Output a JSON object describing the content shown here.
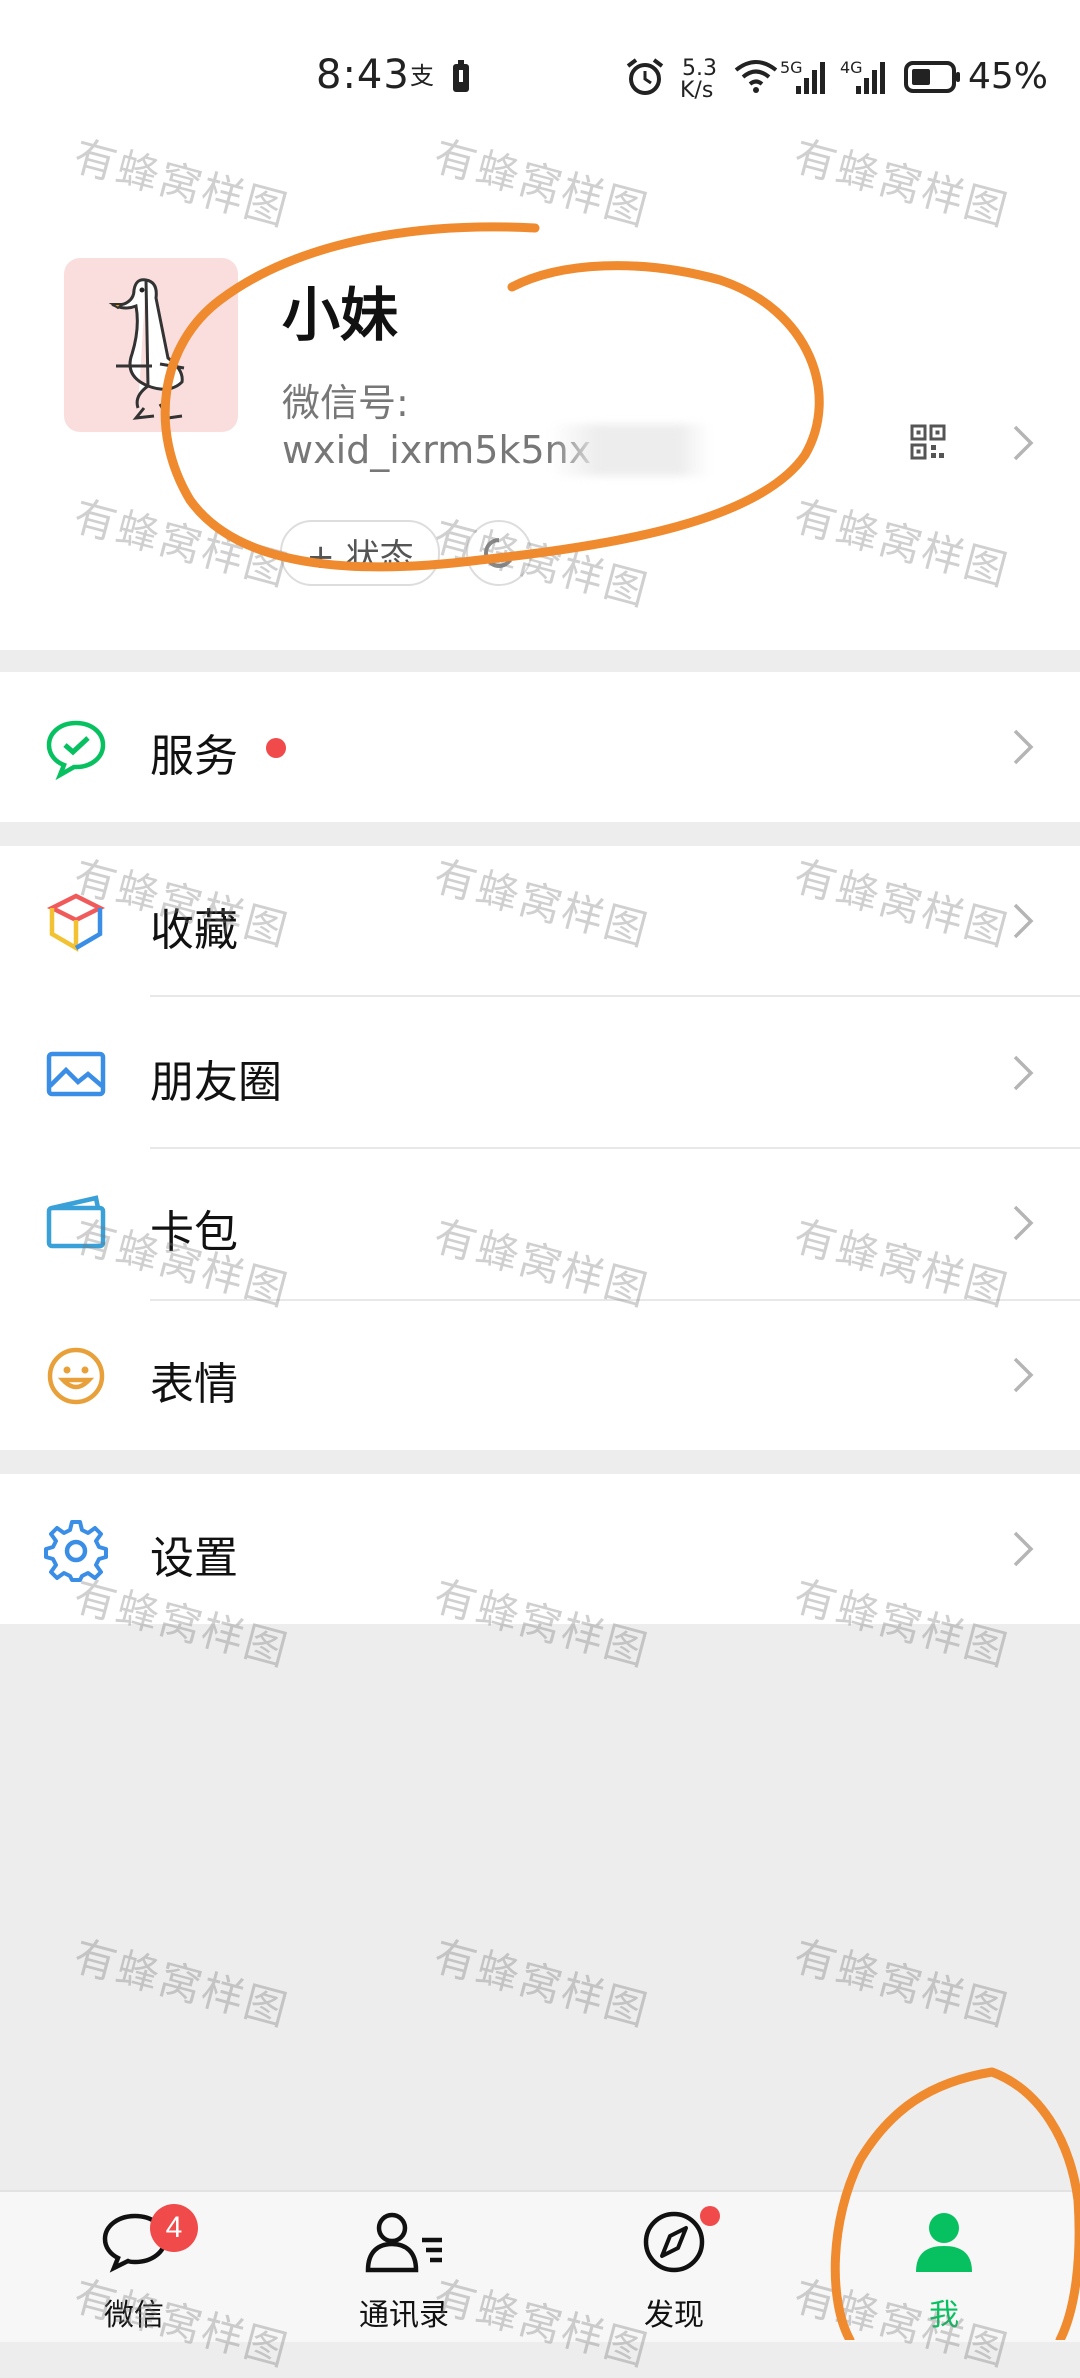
{
  "status_bar": {
    "time": "8:43",
    "net_speed_top": "5.3",
    "net_speed_bottom": "K/s",
    "net_5g": "5G",
    "net_4g": "4G",
    "battery_percent": "45%"
  },
  "profile": {
    "nickname": "小妹",
    "wechat_id_label": "微信号:",
    "wechat_id_value": "wxid_ixrm5k5nx",
    "status_button": "+ 状态"
  },
  "menu": {
    "services": "服务",
    "favorites": "收藏",
    "moments": "朋友圈",
    "cards": "卡包",
    "stickers": "表情",
    "settings": "设置"
  },
  "tabbar": {
    "chats": "微信",
    "chats_badge": "4",
    "contacts": "通讯录",
    "discover": "发现",
    "me": "我"
  },
  "watermark": "有蜂窝样图",
  "colors": {
    "wechat_green": "#07c160",
    "annotation_orange": "#f08a2e",
    "badge_red": "#f04a4a"
  }
}
